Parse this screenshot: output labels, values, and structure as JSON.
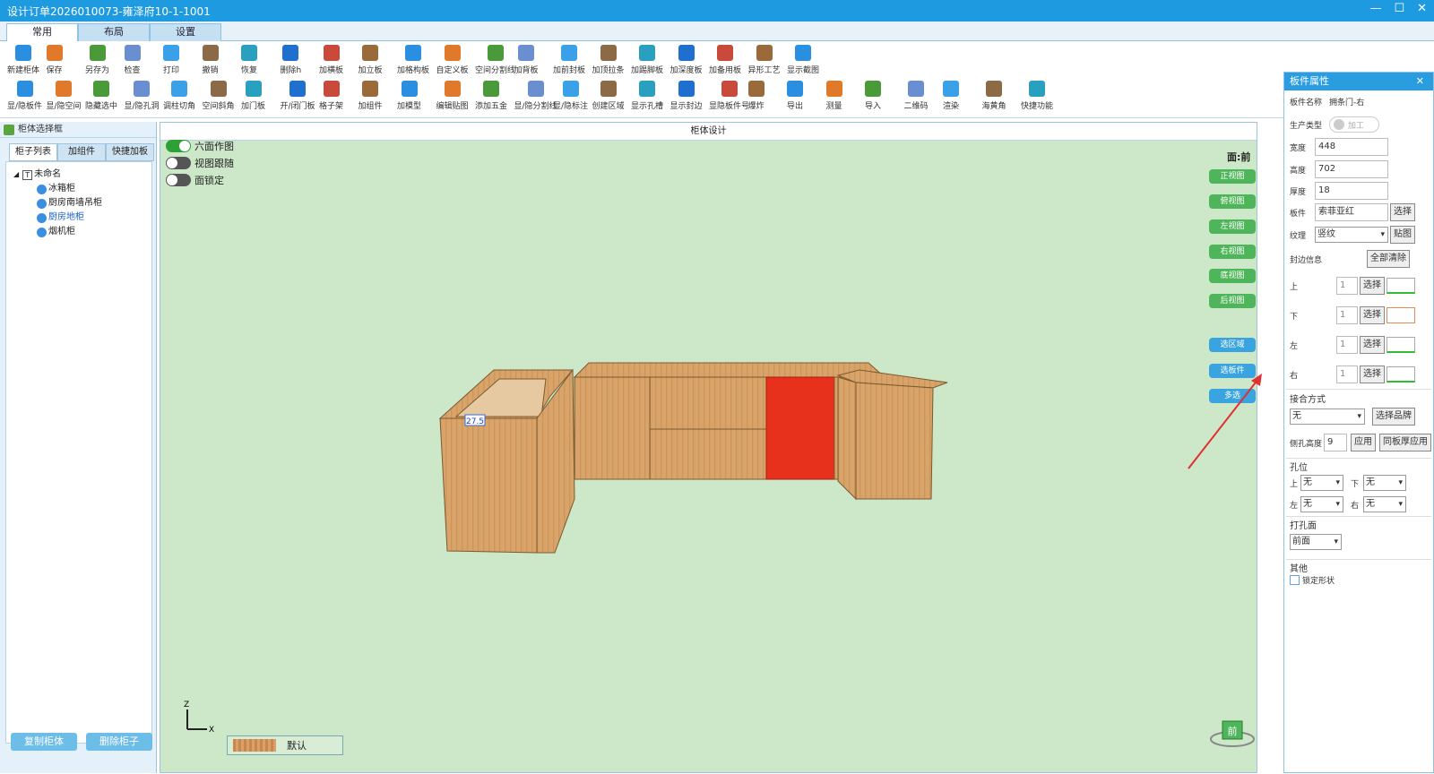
{
  "window": {
    "title": "设计订单2026010073-雍泽府10-1-1001",
    "controls": [
      "—",
      "☐",
      "✕"
    ]
  },
  "tabs": [
    "常用",
    "布局",
    "设置"
  ],
  "toolbar_row1": [
    "新建柜体",
    "保存",
    "另存为",
    "检查",
    "打印",
    "撤销",
    "恢复",
    "删除h",
    "加横板",
    "加立板",
    "加格构板",
    "自定义板",
    "空间分割线",
    "加背板",
    "加前封板",
    "加顶拉条",
    "加踢脚板",
    "加深度板",
    "加备用板",
    "异形工艺",
    "显示截图"
  ],
  "toolbar_row2": [
    "显/隐板件",
    "显/隐空间",
    "隐藏选中",
    "显/隐孔洞",
    "调柱切角",
    "空间斜角",
    "加门板",
    "开/闭门板",
    "格子架",
    "加组件",
    "加模型",
    "编辑贴图",
    "添加五金",
    "显/隐分割线",
    "显/隐标注",
    "创建区域",
    "显示孔槽",
    "显示封边",
    "显隐板件号",
    "爆炸",
    "导出",
    "测量",
    "导入",
    "二维码",
    "渲染",
    "海黄角",
    "快捷功能"
  ],
  "left_panel": {
    "title": "柜体选择框",
    "tabs": [
      "柜子列表",
      "加组件",
      "快捷加板"
    ],
    "tree_root": "未命名",
    "tree_items": [
      "冰箱柜",
      "厨房南墙吊柜",
      "厨房地柜",
      "烟机柜"
    ],
    "buttons": [
      "复制柜体",
      "删除柜子"
    ]
  },
  "main": {
    "title": "柜体设计",
    "toggles": [
      {
        "label": "六面作图",
        "on": true
      },
      {
        "label": "视图跟随",
        "on": false
      },
      {
        "label": "面锁定",
        "on": false
      }
    ],
    "face_label": "面:前",
    "view_buttons": [
      "正视图",
      "俯视图",
      "左视图",
      "右视图",
      "底视图",
      "后视图"
    ],
    "select_buttons": [
      "选区域",
      "选板件",
      "多选"
    ],
    "dimension_tag": "27.5",
    "axis": {
      "z": "Z",
      "x": "X"
    },
    "default_label": "默认",
    "cube_label": "前"
  },
  "right_panel": {
    "title": "板件属性",
    "close": "✕",
    "name_label": "板件名称",
    "name_value": "拥条门-右",
    "prod_label": "生产类型",
    "prod_value": "加工",
    "width_label": "宽度",
    "width_value": "448",
    "height_label": "高度",
    "height_value": "702",
    "thick_label": "厚度",
    "thick_value": "18",
    "board_label": "板件",
    "board_value": "索菲亚红",
    "select_btn": "选择",
    "grain_label": "纹理",
    "grain_value": "竖纹",
    "paste_btn": "贴图",
    "edge_label": "封边信息",
    "clear_all": "全部清除",
    "edges": [
      {
        "side": "上",
        "val": "1"
      },
      {
        "side": "下",
        "val": "1"
      },
      {
        "side": "左",
        "val": "1"
      },
      {
        "side": "右",
        "val": "1"
      }
    ],
    "joint_section": "接合方式",
    "joint_value": "无",
    "brand_btn": "选择品牌",
    "side_hole_label": "侧孔高度",
    "side_hole_value": "9",
    "apply_btn": "应用",
    "same_apply_btn": "同板厚应用",
    "hole_section": "孔位",
    "holes": [
      {
        "side": "上",
        "val": "无"
      },
      {
        "side": "下",
        "val": "无"
      },
      {
        "side": "左",
        "val": "无"
      },
      {
        "side": "右",
        "val": "无"
      }
    ],
    "drill_section": "打孔面",
    "drill_value": "前面",
    "other_section": "其他",
    "lock_label": "锁定形状"
  },
  "colors": {
    "titlebar": "#1e9be0",
    "canvas": "#cde8c8",
    "highlight": "#e8311c",
    "wood": "#d9a46a"
  }
}
